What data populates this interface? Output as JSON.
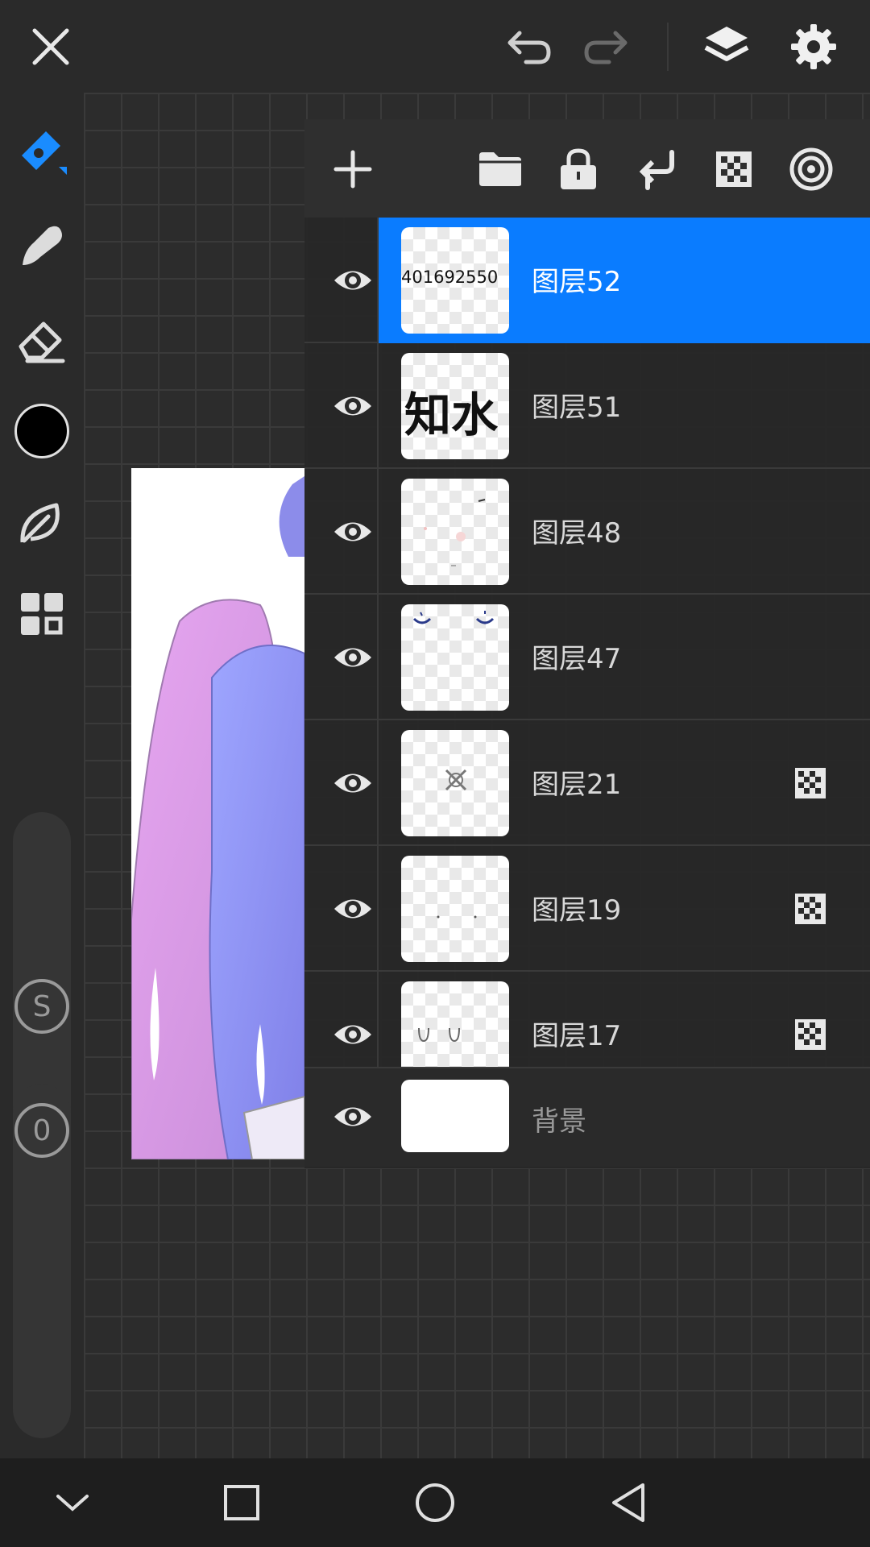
{
  "colors": {
    "accent": "#0a7cff",
    "background": "#2b2b2b",
    "panel": "#282828",
    "current_color": "#000000"
  },
  "topbar": {
    "icons": [
      "close-icon",
      "undo-icon",
      "redo-icon",
      "layers-icon",
      "settings-icon"
    ]
  },
  "toolbar": {
    "tools": [
      "pen-icon",
      "smudge-icon",
      "eraser-icon",
      "color-swatch",
      "leaf-icon",
      "grid-icon"
    ],
    "size_button_label": "S",
    "opacity_button_label": "0"
  },
  "layers_panel": {
    "header_icons": [
      "add-layer-icon",
      "folder-icon",
      "lock-icon",
      "merge-down-icon",
      "alpha-lock-icon",
      "blend-icon"
    ],
    "layers": [
      {
        "name": "图层52",
        "selected": true,
        "thumb_text": "401692550",
        "alpha_lock": false
      },
      {
        "name": "图层51",
        "selected": false,
        "thumb_text": "知水",
        "alpha_lock": false
      },
      {
        "name": "图层48",
        "selected": false,
        "thumb_text": "",
        "alpha_lock": false
      },
      {
        "name": "图层47",
        "selected": false,
        "thumb_text": "",
        "alpha_lock": false
      },
      {
        "name": "图层21",
        "selected": false,
        "thumb_text": "",
        "alpha_lock": true
      },
      {
        "name": "图层19",
        "selected": false,
        "thumb_text": "",
        "alpha_lock": true
      },
      {
        "name": "图层17",
        "selected": false,
        "thumb_text": "",
        "alpha_lock": true
      }
    ],
    "background_layer": {
      "name": "背景"
    }
  },
  "navbar": {
    "icons": [
      "back-chevron-icon",
      "recents-icon",
      "home-icon",
      "back-icon"
    ]
  }
}
